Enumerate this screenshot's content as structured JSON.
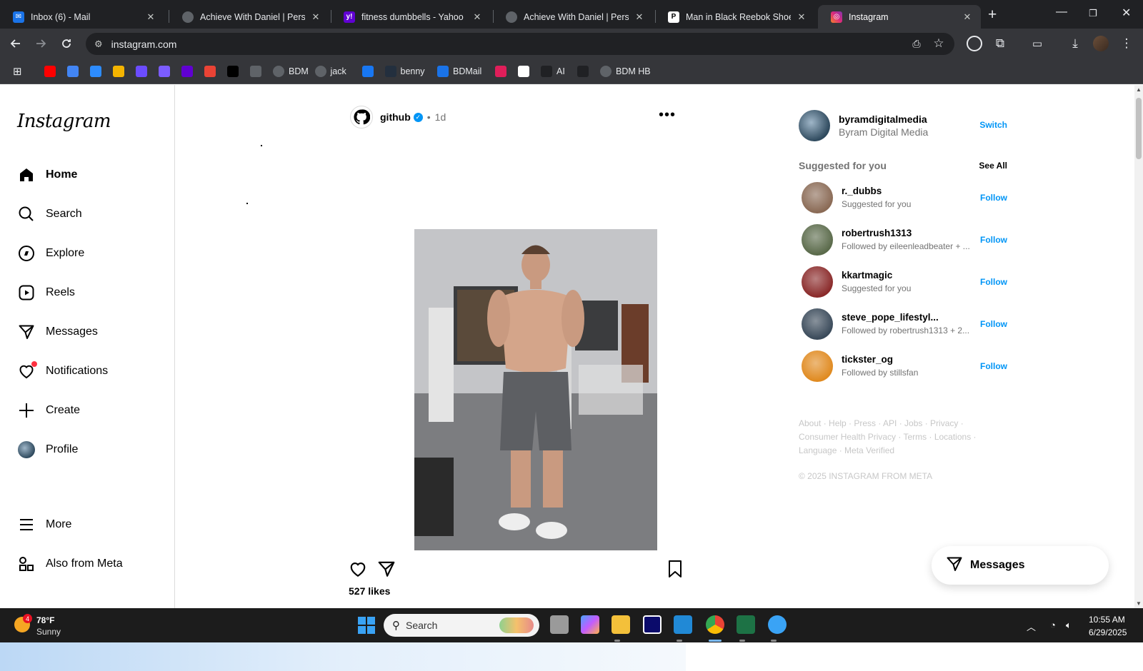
{
  "browser": {
    "tabs": [
      {
        "title": "Inbox (6) - Mail",
        "fav_color": "#1a73e8",
        "fav_icon": "mail-icon"
      },
      {
        "title": "Achieve With Daniel | Persona",
        "fav_color": "#5f6368",
        "fav_icon": "globe-icon"
      },
      {
        "title": "fitness dumbbells - Yahoo Im",
        "fav_color": "#6001d2",
        "fav_icon": "yahoo-icon"
      },
      {
        "title": "Achieve With Daniel | Persona",
        "fav_color": "#5f6368",
        "fav_icon": "globe-icon"
      },
      {
        "title": "Man in Black Reebok Shoes A",
        "fav_color": "#ffffff",
        "fav_icon": "pexels-icon"
      },
      {
        "title": "Instagram",
        "fav_color": "#e1306c",
        "fav_icon": "instagram-icon"
      }
    ],
    "url": "instagram.com",
    "bookmarks": [
      {
        "label": "",
        "icon": "youtube-icon",
        "color": "#ff0000"
      },
      {
        "label": "",
        "icon": "google-icon",
        "color": "#4285f4"
      },
      {
        "label": "",
        "icon": "zoom-icon",
        "color": "#2d8cff"
      },
      {
        "label": "",
        "icon": "stack-icon",
        "color": "#f4b400"
      },
      {
        "label": "",
        "icon": "puzzle-icon",
        "color": "#6b4cff"
      },
      {
        "label": "",
        "icon": "box-icon",
        "color": "#7b5cff"
      },
      {
        "label": "",
        "icon": "yahoo-icon",
        "color": "#6001d2"
      },
      {
        "label": "",
        "icon": "gmail-icon",
        "color": "#ea4335"
      },
      {
        "label": "",
        "icon": "x-icon",
        "color": "#000000"
      },
      {
        "label": "",
        "icon": "code-icon",
        "color": "#5f6368"
      },
      {
        "label": "BDM",
        "icon": "globe-icon",
        "color": "#5f6368"
      },
      {
        "label": "jack",
        "icon": "globe-icon",
        "color": "#5f6368"
      },
      {
        "label": "",
        "icon": "facebook-icon",
        "color": "#1877f2"
      },
      {
        "label": "benny",
        "icon": "aws-icon",
        "color": "#232f3e"
      },
      {
        "label": "BDMail",
        "icon": "mail-icon",
        "color": "#1a73e8"
      },
      {
        "label": "",
        "icon": "slack-icon",
        "color": "#e01e5a"
      },
      {
        "label": "",
        "icon": "pexels-icon",
        "color": "#ffffff"
      },
      {
        "label": "AI",
        "icon": "openai-icon",
        "color": "#202124"
      },
      {
        "label": "",
        "icon": "github-icon",
        "color": "#202124"
      },
      {
        "label": "BDM HB",
        "icon": "globe-icon",
        "color": "#5f6368"
      }
    ]
  },
  "instagram": {
    "logo": "Instagram",
    "nav": [
      {
        "label": "Home",
        "icon": "home-icon"
      },
      {
        "label": "Search",
        "icon": "search-icon"
      },
      {
        "label": "Explore",
        "icon": "compass-icon"
      },
      {
        "label": "Reels",
        "icon": "reels-icon"
      },
      {
        "label": "Messages",
        "icon": "send-icon"
      },
      {
        "label": "Notifications",
        "icon": "heart-icon"
      },
      {
        "label": "Create",
        "icon": "plus-icon"
      },
      {
        "label": "Profile",
        "icon": "profile-avatar"
      },
      {
        "label": "More",
        "icon": "menu-icon"
      },
      {
        "label": "Also from Meta",
        "icon": "meta-apps-icon"
      }
    ],
    "post": {
      "username": "github",
      "separator": "•",
      "time": "1d",
      "likes": "527 likes"
    },
    "me": {
      "username": "byramdigitalmedia",
      "name": "Byram Digital Media",
      "switch_label": "Switch"
    },
    "suggested_header": "Suggested for you",
    "see_all": "See All",
    "follow_label": "Follow",
    "suggestions": [
      {
        "username": "r._dubbs",
        "subtitle": "Suggested for you",
        "color": "#8a6a55"
      },
      {
        "username": "robertrush1313",
        "subtitle": "Followed by eileenleadbeater + ...",
        "color": "#5a6a4a"
      },
      {
        "username": "kkartmagic",
        "subtitle": "Suggested for you",
        "color": "#8a2a2a"
      },
      {
        "username": "steve_pope_lifestyl...",
        "subtitle": "Followed by robertrush1313 + 2...",
        "color": "#3a4a5a"
      },
      {
        "username": "tickster_og",
        "subtitle": "Followed by stillsfan",
        "color": "#e08a20"
      }
    ],
    "footer_line1": "About · Help · Press · API · Jobs · Privacy ·",
    "footer_line2": "Consumer Health Privacy · Terms · Locations ·",
    "footer_line3": "Language · Meta Verified",
    "copyright": "© 2025 INSTAGRAM FROM META",
    "messages_pill": "Messages"
  },
  "taskbar": {
    "weather_badge": "4",
    "temperature": "78°F",
    "condition": "Sunny",
    "search_placeholder": "Search",
    "time": "10:55 AM",
    "date": "6/29/2025"
  }
}
